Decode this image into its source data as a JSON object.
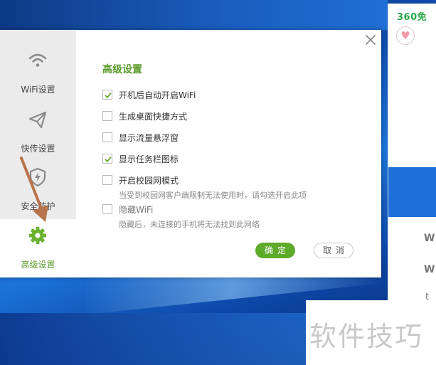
{
  "background_app": {
    "brand": "360免",
    "heart_icon": "heart-icon",
    "fragments": [
      "W",
      "W",
      "t"
    ]
  },
  "dialog": {
    "sidebar": {
      "items": [
        {
          "label": "WiFi设置",
          "icon": "wifi-icon",
          "active": false
        },
        {
          "label": "快传设置",
          "icon": "paper-plane-icon",
          "active": false
        },
        {
          "label": "安全防护",
          "icon": "shield-icon",
          "active": false
        },
        {
          "label": "高级设置",
          "icon": "gear-icon",
          "active": true
        }
      ]
    },
    "close_icon": "close-icon",
    "title": "高级设置",
    "options": [
      {
        "label": "开机后自动开启WiFi",
        "checked": true,
        "enabled": true
      },
      {
        "label": "生成桌面快捷方式",
        "checked": false,
        "enabled": true
      },
      {
        "label": "显示流量悬浮窗",
        "checked": false,
        "enabled": true
      },
      {
        "label": "显示任务栏图标",
        "checked": true,
        "enabled": true
      },
      {
        "label": "开启校园网模式",
        "checked": false,
        "enabled": true,
        "hint": "当受到校园网客户端限制无法使用时，请勾选开启此项"
      },
      {
        "label": "隐藏WiFi",
        "checked": false,
        "enabled": false,
        "hint": "隐藏后，未连接的手机将无法找到此网络"
      }
    ],
    "ok_label": "确定",
    "cancel_label": "取消"
  },
  "colors": {
    "accent_green": "#5eaa2a",
    "title_green": "#5a9a2a",
    "sidebar_bg": "#ebebeb",
    "annotation_arrow": "#b8734a"
  },
  "watermark": "软件技巧"
}
